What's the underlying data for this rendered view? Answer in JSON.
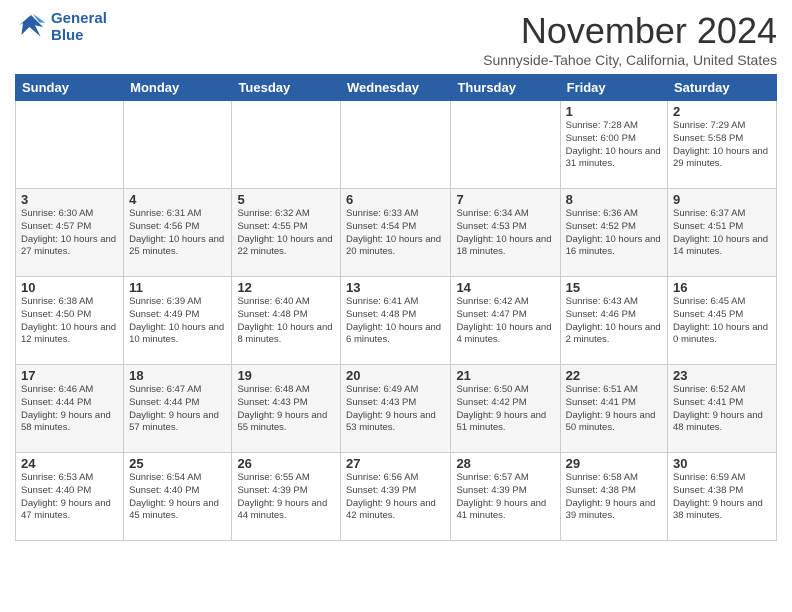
{
  "logo": {
    "line1": "General",
    "line2": "Blue"
  },
  "header": {
    "month": "November 2024",
    "location": "Sunnyside-Tahoe City, California, United States"
  },
  "weekdays": [
    "Sunday",
    "Monday",
    "Tuesday",
    "Wednesday",
    "Thursday",
    "Friday",
    "Saturday"
  ],
  "weeks": [
    [
      {
        "day": "",
        "info": ""
      },
      {
        "day": "",
        "info": ""
      },
      {
        "day": "",
        "info": ""
      },
      {
        "day": "",
        "info": ""
      },
      {
        "day": "",
        "info": ""
      },
      {
        "day": "1",
        "info": "Sunrise: 7:28 AM\nSunset: 6:00 PM\nDaylight: 10 hours and 31 minutes."
      },
      {
        "day": "2",
        "info": "Sunrise: 7:29 AM\nSunset: 5:58 PM\nDaylight: 10 hours and 29 minutes."
      }
    ],
    [
      {
        "day": "3",
        "info": "Sunrise: 6:30 AM\nSunset: 4:57 PM\nDaylight: 10 hours and 27 minutes."
      },
      {
        "day": "4",
        "info": "Sunrise: 6:31 AM\nSunset: 4:56 PM\nDaylight: 10 hours and 25 minutes."
      },
      {
        "day": "5",
        "info": "Sunrise: 6:32 AM\nSunset: 4:55 PM\nDaylight: 10 hours and 22 minutes."
      },
      {
        "day": "6",
        "info": "Sunrise: 6:33 AM\nSunset: 4:54 PM\nDaylight: 10 hours and 20 minutes."
      },
      {
        "day": "7",
        "info": "Sunrise: 6:34 AM\nSunset: 4:53 PM\nDaylight: 10 hours and 18 minutes."
      },
      {
        "day": "8",
        "info": "Sunrise: 6:36 AM\nSunset: 4:52 PM\nDaylight: 10 hours and 16 minutes."
      },
      {
        "day": "9",
        "info": "Sunrise: 6:37 AM\nSunset: 4:51 PM\nDaylight: 10 hours and 14 minutes."
      }
    ],
    [
      {
        "day": "10",
        "info": "Sunrise: 6:38 AM\nSunset: 4:50 PM\nDaylight: 10 hours and 12 minutes."
      },
      {
        "day": "11",
        "info": "Sunrise: 6:39 AM\nSunset: 4:49 PM\nDaylight: 10 hours and 10 minutes."
      },
      {
        "day": "12",
        "info": "Sunrise: 6:40 AM\nSunset: 4:48 PM\nDaylight: 10 hours and 8 minutes."
      },
      {
        "day": "13",
        "info": "Sunrise: 6:41 AM\nSunset: 4:48 PM\nDaylight: 10 hours and 6 minutes."
      },
      {
        "day": "14",
        "info": "Sunrise: 6:42 AM\nSunset: 4:47 PM\nDaylight: 10 hours and 4 minutes."
      },
      {
        "day": "15",
        "info": "Sunrise: 6:43 AM\nSunset: 4:46 PM\nDaylight: 10 hours and 2 minutes."
      },
      {
        "day": "16",
        "info": "Sunrise: 6:45 AM\nSunset: 4:45 PM\nDaylight: 10 hours and 0 minutes."
      }
    ],
    [
      {
        "day": "17",
        "info": "Sunrise: 6:46 AM\nSunset: 4:44 PM\nDaylight: 9 hours and 58 minutes."
      },
      {
        "day": "18",
        "info": "Sunrise: 6:47 AM\nSunset: 4:44 PM\nDaylight: 9 hours and 57 minutes."
      },
      {
        "day": "19",
        "info": "Sunrise: 6:48 AM\nSunset: 4:43 PM\nDaylight: 9 hours and 55 minutes."
      },
      {
        "day": "20",
        "info": "Sunrise: 6:49 AM\nSunset: 4:43 PM\nDaylight: 9 hours and 53 minutes."
      },
      {
        "day": "21",
        "info": "Sunrise: 6:50 AM\nSunset: 4:42 PM\nDaylight: 9 hours and 51 minutes."
      },
      {
        "day": "22",
        "info": "Sunrise: 6:51 AM\nSunset: 4:41 PM\nDaylight: 9 hours and 50 minutes."
      },
      {
        "day": "23",
        "info": "Sunrise: 6:52 AM\nSunset: 4:41 PM\nDaylight: 9 hours and 48 minutes."
      }
    ],
    [
      {
        "day": "24",
        "info": "Sunrise: 6:53 AM\nSunset: 4:40 PM\nDaylight: 9 hours and 47 minutes."
      },
      {
        "day": "25",
        "info": "Sunrise: 6:54 AM\nSunset: 4:40 PM\nDaylight: 9 hours and 45 minutes."
      },
      {
        "day": "26",
        "info": "Sunrise: 6:55 AM\nSunset: 4:39 PM\nDaylight: 9 hours and 44 minutes."
      },
      {
        "day": "27",
        "info": "Sunrise: 6:56 AM\nSunset: 4:39 PM\nDaylight: 9 hours and 42 minutes."
      },
      {
        "day": "28",
        "info": "Sunrise: 6:57 AM\nSunset: 4:39 PM\nDaylight: 9 hours and 41 minutes."
      },
      {
        "day": "29",
        "info": "Sunrise: 6:58 AM\nSunset: 4:38 PM\nDaylight: 9 hours and 39 minutes."
      },
      {
        "day": "30",
        "info": "Sunrise: 6:59 AM\nSunset: 4:38 PM\nDaylight: 9 hours and 38 minutes."
      }
    ]
  ]
}
